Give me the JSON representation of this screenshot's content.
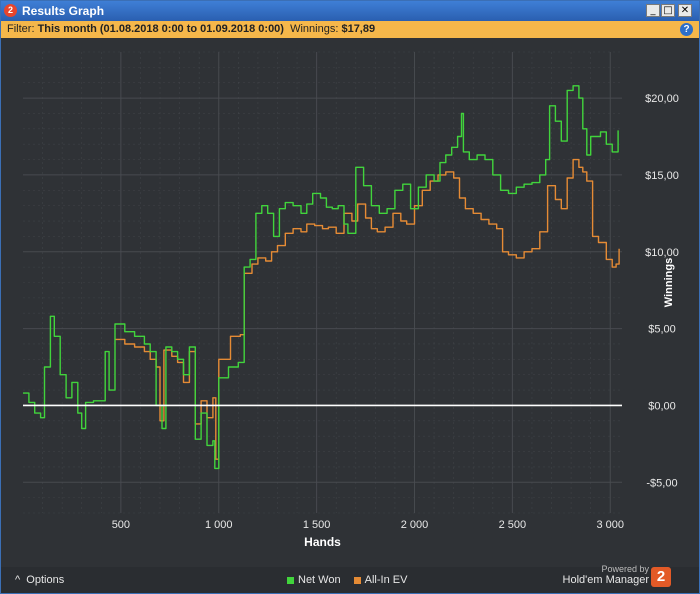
{
  "window": {
    "app_icon_label": "2",
    "title": "Results Graph",
    "min_label": "_",
    "max_label": "□",
    "close_label": "✕"
  },
  "filter": {
    "prefix": "Filter:",
    "value": "This month (01.08.2018 0:00 to 01.09.2018 0:00)",
    "winnings_label": "Winnings:",
    "winnings_value": "$17,89",
    "help_icon": "?"
  },
  "footer": {
    "options_label": "Options",
    "options_icon": "^",
    "powered_by": "Powered by",
    "brand": "Hold'em Manager",
    "brand_logo": "2"
  },
  "colors": {
    "net_won": "#41d43c",
    "all_in_ev": "#e58b35",
    "zero_line": "#ffffff",
    "plot_bg": "#2f3236",
    "grid": "#4a4d52"
  },
  "chart_data": {
    "type": "line",
    "xlabel": "Hands",
    "ylabel": "Winnings",
    "xlim": [
      0,
      3060
    ],
    "ylim": [
      -7,
      23
    ],
    "x_ticks": [
      500,
      1000,
      1500,
      2000,
      2500,
      3000
    ],
    "x_tick_labels": [
      "500",
      "1 000",
      "1 500",
      "2 000",
      "2 500",
      "3 000"
    ],
    "y_ticks": [
      -5,
      0,
      5,
      10,
      15,
      20
    ],
    "y_tick_labels": [
      "-$5,00",
      "$0,00",
      "$5,00",
      "$10,00",
      "$15,00",
      "$20,00"
    ],
    "grid": true,
    "legend_position": "bottom-center",
    "series": [
      {
        "name": "Net Won",
        "color": "#41d43c",
        "points": [
          [
            0,
            0.8
          ],
          [
            30,
            0.2
          ],
          [
            60,
            -0.5
          ],
          [
            90,
            -0.8
          ],
          [
            110,
            2.5
          ],
          [
            140,
            5.8
          ],
          [
            160,
            4.5
          ],
          [
            190,
            2.0
          ],
          [
            220,
            0.5
          ],
          [
            250,
            1.5
          ],
          [
            280,
            -0.5
          ],
          [
            300,
            -1.5
          ],
          [
            320,
            0.2
          ],
          [
            360,
            0.3
          ],
          [
            420,
            3.5
          ],
          [
            440,
            1.0
          ],
          [
            470,
            5.3
          ],
          [
            520,
            4.8
          ],
          [
            570,
            4.5
          ],
          [
            620,
            4.0
          ],
          [
            650,
            3.5
          ],
          [
            680,
            0
          ],
          [
            710,
            -1.5
          ],
          [
            730,
            3.8
          ],
          [
            760,
            3.5
          ],
          [
            790,
            3.0
          ],
          [
            820,
            2.0
          ],
          [
            850,
            3.8
          ],
          [
            880,
            -2.2
          ],
          [
            910,
            -0.5
          ],
          [
            940,
            -2.6
          ],
          [
            970,
            -2.3
          ],
          [
            980,
            -4.1
          ],
          [
            1000,
            1.8
          ],
          [
            1050,
            2.5
          ],
          [
            1100,
            2.8
          ],
          [
            1130,
            9.0
          ],
          [
            1160,
            9.5
          ],
          [
            1190,
            12.5
          ],
          [
            1220,
            13.0
          ],
          [
            1250,
            12.5
          ],
          [
            1280,
            11.0
          ],
          [
            1310,
            12.8
          ],
          [
            1340,
            13.2
          ],
          [
            1380,
            13.0
          ],
          [
            1420,
            12.5
          ],
          [
            1450,
            13.1
          ],
          [
            1480,
            13.8
          ],
          [
            1520,
            13.5
          ],
          [
            1550,
            12.9
          ],
          [
            1580,
            12.8
          ],
          [
            1610,
            13.0
          ],
          [
            1640,
            11.8
          ],
          [
            1660,
            11.2
          ],
          [
            1700,
            15.5
          ],
          [
            1740,
            14.3
          ],
          [
            1780,
            13.0
          ],
          [
            1820,
            12.5
          ],
          [
            1860,
            12.8
          ],
          [
            1900,
            14.0
          ],
          [
            1940,
            14.4
          ],
          [
            1980,
            12.8
          ],
          [
            2020,
            14.2
          ],
          [
            2060,
            15.0
          ],
          [
            2100,
            14.6
          ],
          [
            2130,
            15.8
          ],
          [
            2160,
            16.3
          ],
          [
            2190,
            16.8
          ],
          [
            2220,
            17.5
          ],
          [
            2240,
            19.0
          ],
          [
            2250,
            16.5
          ],
          [
            2280,
            16.0
          ],
          [
            2320,
            16.3
          ],
          [
            2360,
            16.0
          ],
          [
            2400,
            15.0
          ],
          [
            2440,
            14.0
          ],
          [
            2480,
            13.8
          ],
          [
            2520,
            14.2
          ],
          [
            2560,
            14.4
          ],
          [
            2600,
            14.5
          ],
          [
            2640,
            15.0
          ],
          [
            2670,
            16.0
          ],
          [
            2690,
            19.5
          ],
          [
            2720,
            18.5
          ],
          [
            2750,
            17.2
          ],
          [
            2780,
            20.5
          ],
          [
            2810,
            20.8
          ],
          [
            2840,
            20.0
          ],
          [
            2860,
            18.0
          ],
          [
            2880,
            16.3
          ],
          [
            2900,
            17.5
          ],
          [
            2950,
            17.8
          ],
          [
            2980,
            17.0
          ],
          [
            3010,
            16.5
          ],
          [
            3040,
            17.9
          ]
        ]
      },
      {
        "name": "All-In EV",
        "color": "#e58b35",
        "points": [
          [
            470,
            4.3
          ],
          [
            520,
            4.0
          ],
          [
            570,
            3.8
          ],
          [
            620,
            3.5
          ],
          [
            650,
            3.0
          ],
          [
            680,
            2.5
          ],
          [
            700,
            -1.0
          ],
          [
            720,
            3.6
          ],
          [
            760,
            3.2
          ],
          [
            790,
            2.8
          ],
          [
            820,
            1.5
          ],
          [
            850,
            3.5
          ],
          [
            880,
            -1.2
          ],
          [
            910,
            0.3
          ],
          [
            940,
            -0.8
          ],
          [
            970,
            0.5
          ],
          [
            985,
            -3.5
          ],
          [
            1000,
            3.0
          ],
          [
            1060,
            4.5
          ],
          [
            1110,
            4.6
          ],
          [
            1130,
            8.6
          ],
          [
            1170,
            9.2
          ],
          [
            1200,
            9.6
          ],
          [
            1240,
            9.4
          ],
          [
            1270,
            10.0
          ],
          [
            1300,
            10.4
          ],
          [
            1340,
            11.2
          ],
          [
            1380,
            11.5
          ],
          [
            1420,
            11.3
          ],
          [
            1450,
            11.8
          ],
          [
            1490,
            11.7
          ],
          [
            1530,
            11.5
          ],
          [
            1560,
            11.6
          ],
          [
            1600,
            11.2
          ],
          [
            1640,
            12.5
          ],
          [
            1680,
            12.0
          ],
          [
            1710,
            13.1
          ],
          [
            1750,
            12.2
          ],
          [
            1780,
            11.5
          ],
          [
            1810,
            11.3
          ],
          [
            1850,
            11.6
          ],
          [
            1890,
            12.5
          ],
          [
            1930,
            12.0
          ],
          [
            1960,
            11.8
          ],
          [
            2000,
            13.0
          ],
          [
            2040,
            14.0
          ],
          [
            2080,
            14.6
          ],
          [
            2120,
            15.0
          ],
          [
            2160,
            15.2
          ],
          [
            2200,
            14.8
          ],
          [
            2230,
            13.5
          ],
          [
            2260,
            12.8
          ],
          [
            2300,
            12.5
          ],
          [
            2340,
            12.1
          ],
          [
            2380,
            11.8
          ],
          [
            2420,
            11.5
          ],
          [
            2450,
            10.0
          ],
          [
            2480,
            9.8
          ],
          [
            2520,
            9.6
          ],
          [
            2560,
            10.0
          ],
          [
            2600,
            10.2
          ],
          [
            2640,
            11.3
          ],
          [
            2680,
            14.3
          ],
          [
            2720,
            13.4
          ],
          [
            2750,
            12.8
          ],
          [
            2780,
            14.8
          ],
          [
            2810,
            16.0
          ],
          [
            2840,
            15.5
          ],
          [
            2860,
            15.2
          ],
          [
            2880,
            14.6
          ],
          [
            2910,
            11.0
          ],
          [
            2940,
            10.6
          ],
          [
            2980,
            9.5
          ],
          [
            3010,
            9.0
          ],
          [
            3030,
            9.2
          ],
          [
            3045,
            10.2
          ]
        ]
      }
    ]
  }
}
